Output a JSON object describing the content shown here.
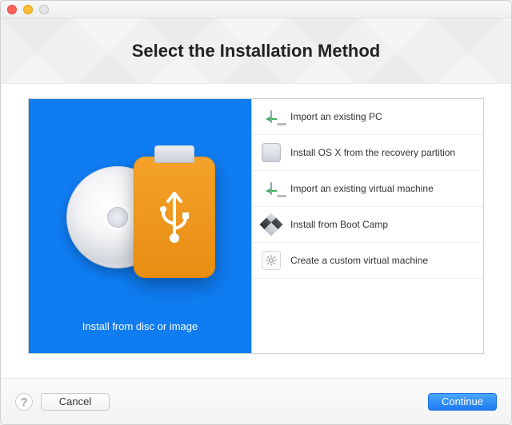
{
  "header": {
    "title": "Select the Installation Method"
  },
  "left": {
    "caption": "Install from disc or image",
    "icon": "disc-usb-icon"
  },
  "methods": [
    {
      "label": "Import an existing PC",
      "icon": "monitor-import-icon",
      "selected": true
    },
    {
      "label": "Install OS X from the recovery partition",
      "icon": "hdd-icon",
      "selected": false
    },
    {
      "label": "Import an existing virtual machine",
      "icon": "monitor-vm-icon",
      "selected": false
    },
    {
      "label": "Install from Boot Camp",
      "icon": "bootcamp-icon",
      "selected": false
    },
    {
      "label": "Create a custom virtual machine",
      "icon": "gear-doc-icon",
      "selected": false
    }
  ],
  "footer": {
    "help": "?",
    "cancel": "Cancel",
    "continue": "Continue"
  }
}
